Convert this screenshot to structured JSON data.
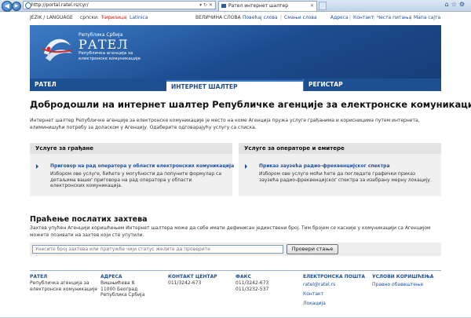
{
  "browser": {
    "url": "http://portal.ratel.rs/cyr/",
    "tab_title": "Рател интернет шалтер"
  },
  "topbar": {
    "language_label": "JEZIK / LANGUAGE",
    "lang_serbian": "српски:",
    "lang_cyr": "Ћирилица",
    "lang_sep": "|",
    "lang_lat": "Latinica",
    "font_size_label": "ВЕЛИЧИНА СЛОВА",
    "increase": "Повећај слова",
    "decrease": "Смањи слова",
    "links": [
      "Адреса",
      "Контакт",
      "Честа питања",
      "Мапа сајта"
    ]
  },
  "header": {
    "republic": "Република Србија",
    "name": "РАТЕЛ",
    "sub1": "Републичка агенција за",
    "sub2": "електронске комуникације"
  },
  "nav": {
    "items": [
      "РАТЕЛ",
      "ИНТЕРНЕТ ШАЛТЕР",
      "РЕГИСТАР"
    ]
  },
  "main": {
    "title": "Добродошли на интернет шалтер Републичке агенције за електронске комуникације",
    "intro": "Интернет шалтер Републичке агенције за електронске комуникације је место на коме Агенција пружа услуге грађанима и корисницима путем интернета, елиминишући потребу за доласком у Агенцију. Одаберите одговарајућу услугу са списка."
  },
  "services": [
    {
      "title": "Услуге за грађане",
      "link": "Приговор на рад оператора у области електронских комуникација",
      "desc": "Избором ове услуге, бићете у могућности да попуните формулар са детаљима вашег приговора на рад оператора у области електронских комуникација."
    },
    {
      "title": "Услуге за операторе и емитере",
      "link": "Приказ заузећа радио-фреквенцијског спектра",
      "desc": "Избором ове услуге моћи ћете да погледате графички приказ заузећа радио-фреквенцијског спектра за изабрану мерну локацију."
    }
  ],
  "tracking": {
    "title": "Праћење послатих захтева",
    "desc": "Захтев упућен Агенцији коришћењем Интернет шалтера може да себе имати дефинисан јединствени број. Тим бројем се касније у комуникацији са Агенцијом можете позивати на захтев који сте упутили.",
    "placeholder": "Унесите број захтева или притужбе чији статус желите да проверите",
    "button": "Провери стање"
  },
  "footer": {
    "col1": {
      "h": "РАТЕЛ",
      "l1": "Републичка агенција за",
      "l2": "електронске комуникације"
    },
    "col2": {
      "h": "АДРЕСА",
      "l1": "Вишњићева 8",
      "l2": "11000 Београд",
      "l3": "Република Србија"
    },
    "col3": {
      "h": "КОНТАКТ ЦЕНТАР",
      "l1": "011/3242-673"
    },
    "col4": {
      "h": "ФАКС",
      "l1": "011/3242-673",
      "l2": "011/3232-537"
    },
    "col5": {
      "h": "ЕЛЕКТРОНСКА ПОШТА",
      "links": [
        "ratel@ratel.rs",
        "Контакт",
        "Локација"
      ]
    },
    "col6": {
      "h": "УСЛОВИ КОРИШЋЕЊА",
      "links": [
        "Правно обавештење"
      ]
    }
  },
  "colors": {
    "brand": "#1d4f93",
    "header_light": "#3c7cc6",
    "accent_red": "#c0261d"
  }
}
